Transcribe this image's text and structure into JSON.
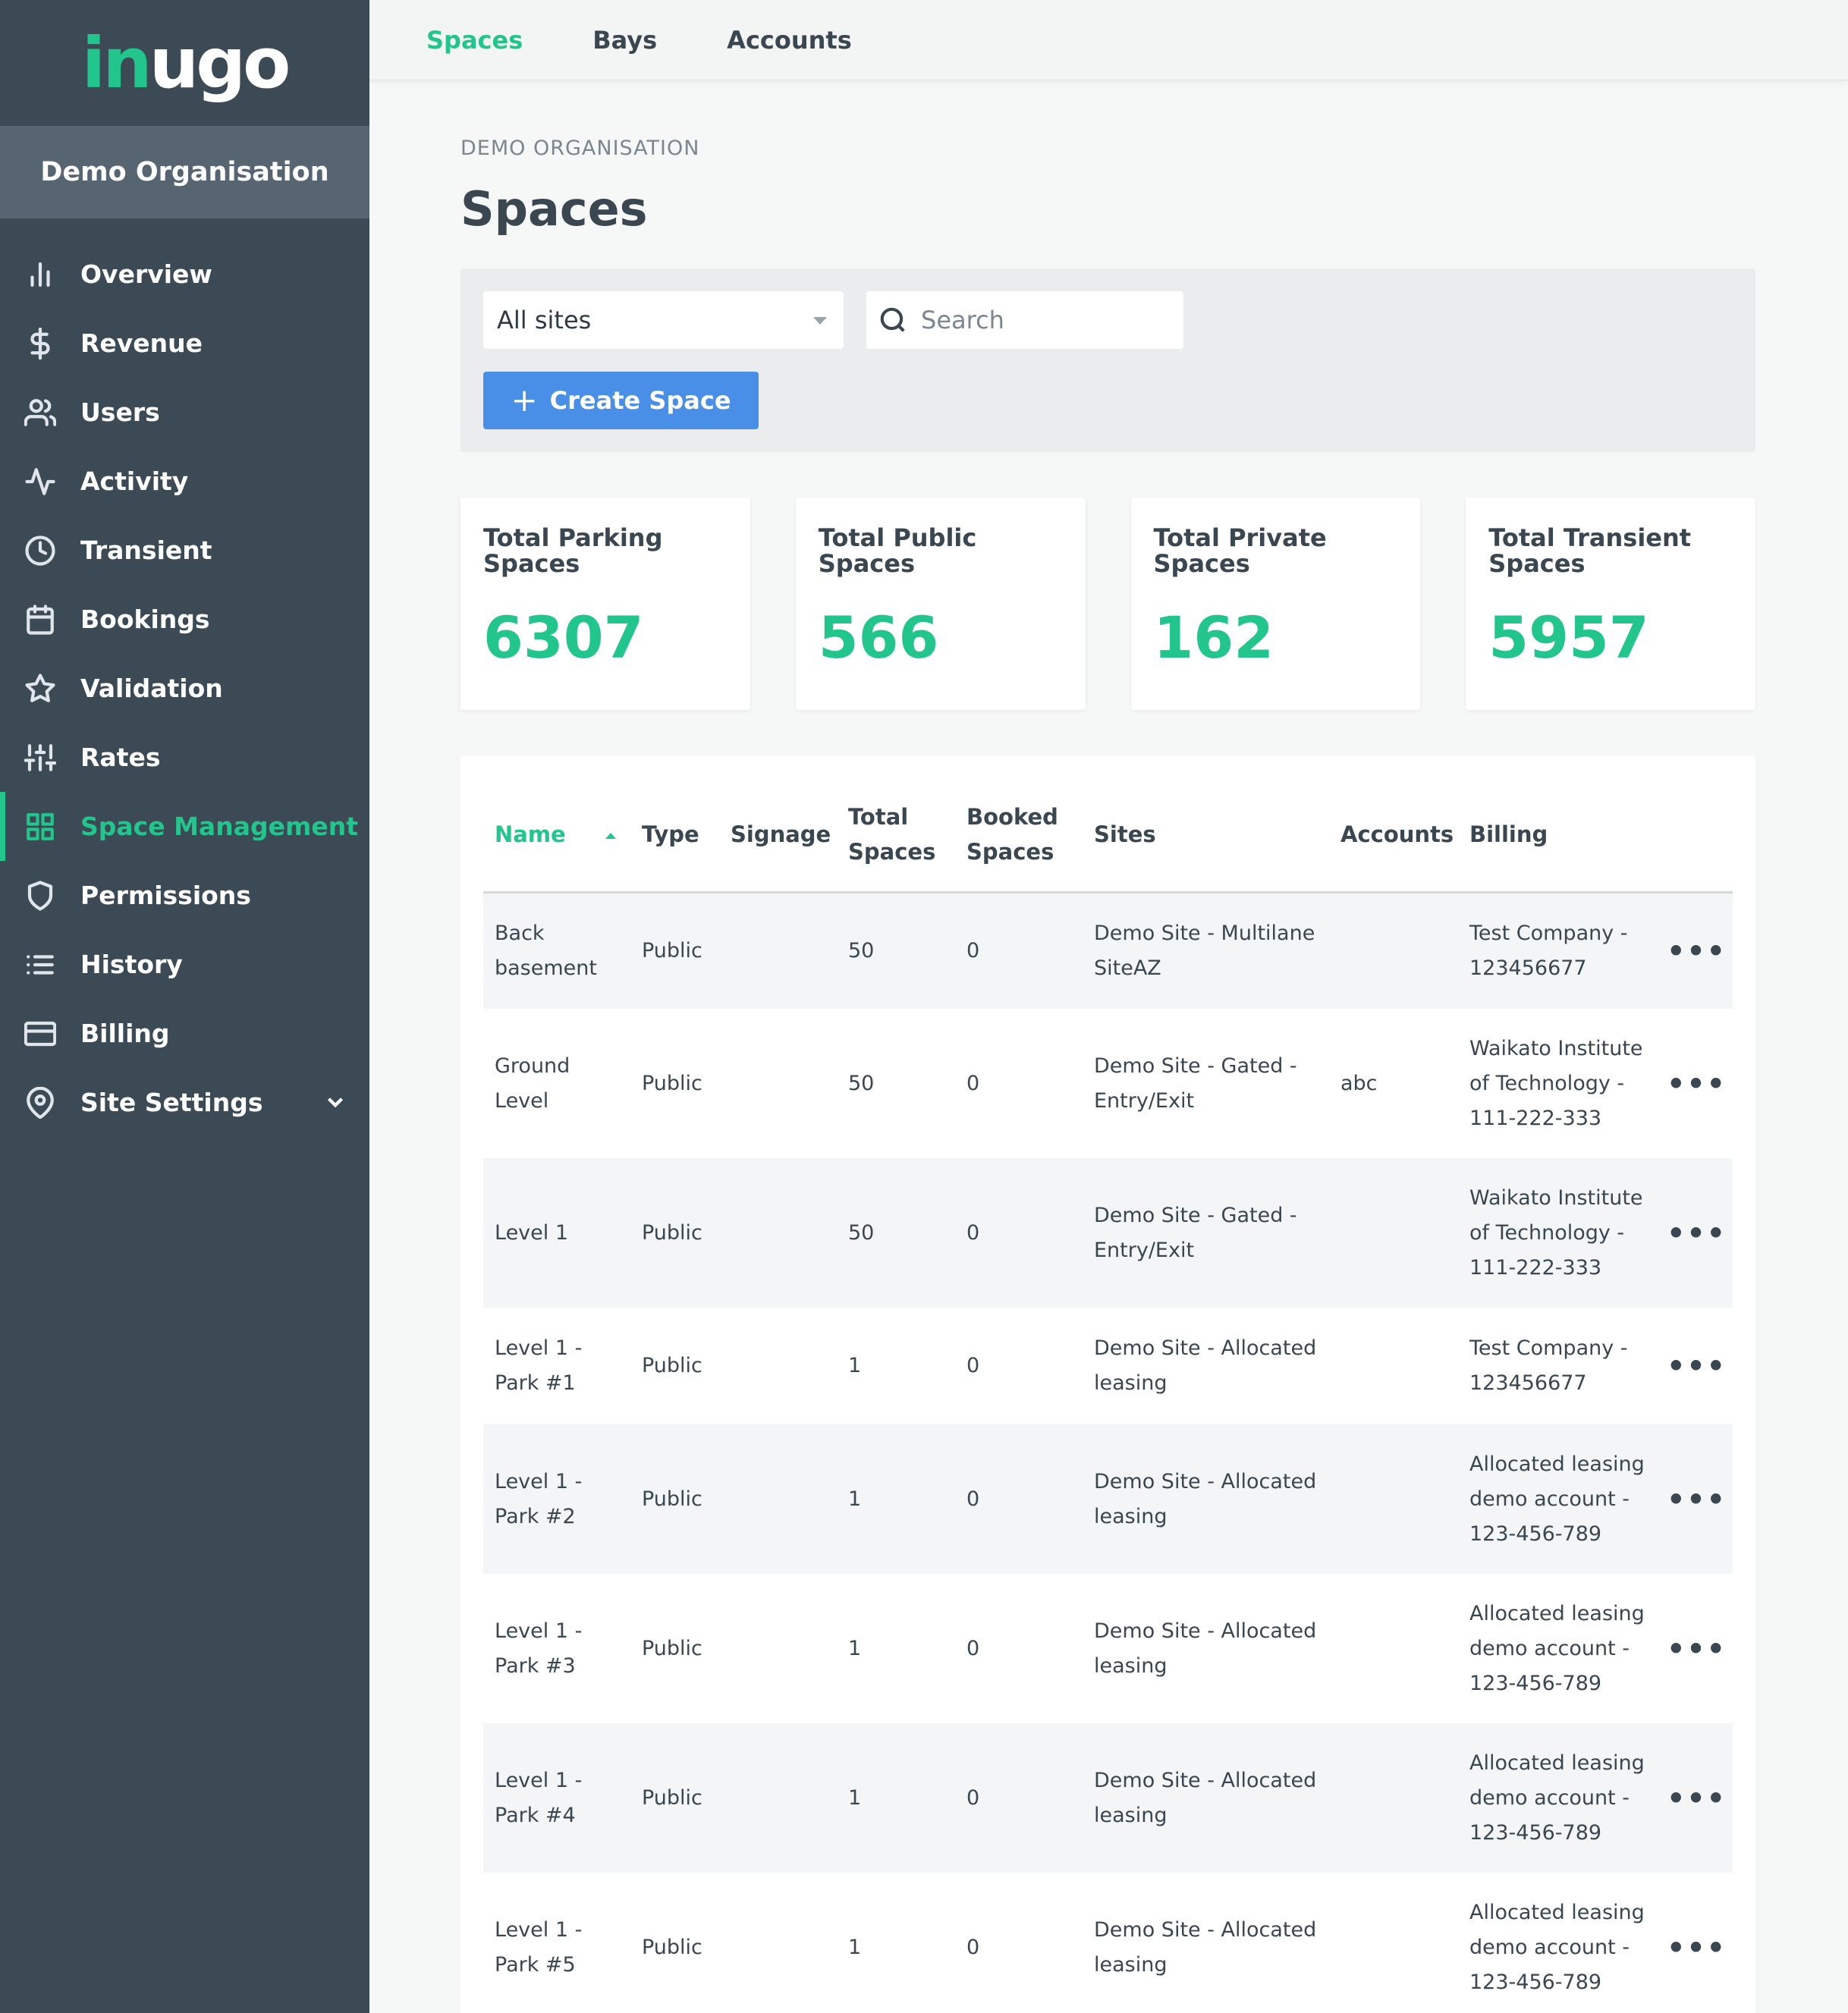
{
  "app": {
    "logo_part1": "in",
    "logo_part2": "ugo",
    "organisation": "Demo Organisation"
  },
  "sidebar": {
    "items": [
      {
        "label": "Overview",
        "icon": "bar-chart-icon"
      },
      {
        "label": "Revenue",
        "icon": "dollar-icon"
      },
      {
        "label": "Users",
        "icon": "users-icon"
      },
      {
        "label": "Activity",
        "icon": "activity-icon"
      },
      {
        "label": "Transient",
        "icon": "clock-icon"
      },
      {
        "label": "Bookings",
        "icon": "calendar-icon"
      },
      {
        "label": "Validation",
        "icon": "star-icon"
      },
      {
        "label": "Rates",
        "icon": "sliders-icon"
      },
      {
        "label": "Space Management",
        "icon": "grid-icon",
        "active": true
      },
      {
        "label": "Permissions",
        "icon": "shield-icon"
      },
      {
        "label": "History",
        "icon": "list-icon"
      },
      {
        "label": "Billing",
        "icon": "credit-card-icon"
      },
      {
        "label": "Site Settings",
        "icon": "map-pin-icon",
        "expandable": true
      }
    ]
  },
  "topnav": {
    "tabs": [
      {
        "label": "Spaces",
        "active": true
      },
      {
        "label": "Bays"
      },
      {
        "label": "Accounts"
      }
    ]
  },
  "main": {
    "breadcrumb": "DEMO ORGANISATION",
    "title": "Spaces",
    "filters": {
      "site_select": "All sites",
      "search_placeholder": "Search",
      "create_button": "Create Space"
    },
    "stats": [
      {
        "label": "Total Parking Spaces",
        "value": "6307"
      },
      {
        "label": "Total Public Spaces",
        "value": "566"
      },
      {
        "label": "Total Private Spaces",
        "value": "162"
      },
      {
        "label": "Total Transient Spaces",
        "value": "5957"
      }
    ],
    "table": {
      "headers": {
        "name": "Name",
        "type": "Type",
        "signage": "Signage",
        "total_1": "Total",
        "total_2": "Spaces",
        "booked_1": "Booked",
        "booked_2": "Spaces",
        "sites": "Sites",
        "accounts": "Accounts",
        "billing": "Billing"
      },
      "rows": [
        {
          "name1": "Back",
          "name2": "basement",
          "type": "Public",
          "signage": "",
          "total": "50",
          "booked": "0",
          "site1": "Demo Site - Multilane",
          "site2": "SiteAZ",
          "accounts": "",
          "bill1": "Test Company -",
          "bill2": "123456677",
          "bill3": "",
          "menu": "•••"
        },
        {
          "name1": "Ground",
          "name2": "Level",
          "type": "Public",
          "signage": "",
          "total": "50",
          "booked": "0",
          "site1": "Demo Site - Gated -",
          "site2": "Entry/Exit",
          "accounts": "abc",
          "bill1": "Waikato Institute",
          "bill2": "of Technology -",
          "bill3": "111-222-333",
          "menu": "•••"
        },
        {
          "name1": "Level 1",
          "name2": "",
          "type": "Public",
          "signage": "",
          "total": "50",
          "booked": "0",
          "site1": "Demo Site - Gated -",
          "site2": "Entry/Exit",
          "accounts": "",
          "bill1": "Waikato Institute",
          "bill2": "of Technology -",
          "bill3": "111-222-333",
          "menu": "•••"
        },
        {
          "name1": "Level 1 -",
          "name2": "Park #1",
          "type": "Public",
          "signage": "",
          "total": "1",
          "booked": "0",
          "site1": "Demo Site - Allocated",
          "site2": "leasing",
          "accounts": "",
          "bill1": "Test Company -",
          "bill2": "123456677",
          "bill3": "",
          "menu": "•••"
        },
        {
          "name1": "Level 1 -",
          "name2": "Park #2",
          "type": "Public",
          "signage": "",
          "total": "1",
          "booked": "0",
          "site1": "Demo Site - Allocated",
          "site2": "leasing",
          "accounts": "",
          "bill1": "Allocated leasing",
          "bill2": "demo account -",
          "bill3": "123-456-789",
          "menu": "•••"
        },
        {
          "name1": "Level 1 -",
          "name2": "Park #3",
          "type": "Public",
          "signage": "",
          "total": "1",
          "booked": "0",
          "site1": "Demo Site - Allocated",
          "site2": "leasing",
          "accounts": "",
          "bill1": "Allocated leasing",
          "bill2": "demo account -",
          "bill3": "123-456-789",
          "menu": "•••"
        },
        {
          "name1": "Level 1 -",
          "name2": "Park #4",
          "type": "Public",
          "signage": "",
          "total": "1",
          "booked": "0",
          "site1": "Demo Site - Allocated",
          "site2": "leasing",
          "accounts": "",
          "bill1": "Allocated leasing",
          "bill2": "demo account -",
          "bill3": "123-456-789",
          "menu": "•••"
        },
        {
          "name1": "Level 1 -",
          "name2": "Park #5",
          "type": "Public",
          "signage": "",
          "total": "1",
          "booked": "0",
          "site1": "Demo Site - Allocated",
          "site2": "leasing",
          "accounts": "",
          "bill1": "Allocated leasing",
          "bill2": "demo account -",
          "bill3": "123-456-789",
          "menu": "•••"
        }
      ]
    }
  },
  "colors": {
    "sidebar_bg": "#3b4a55",
    "org_bg": "#566571",
    "accent_green": "#22c58b",
    "button_blue": "#4a8fe7"
  }
}
